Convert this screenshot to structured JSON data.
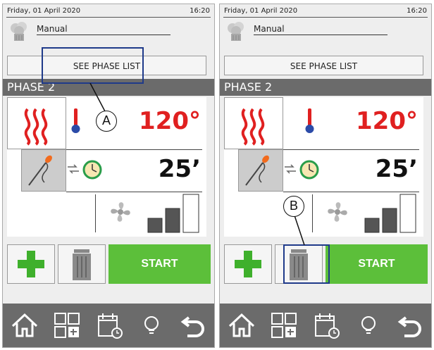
{
  "status": {
    "date": "Friday, 01 April 2020",
    "time": "16:20"
  },
  "mode": "Manual",
  "phase_list_button": "SEE PHASE LIST",
  "phase": "PHASE 2",
  "temperature": "120°",
  "duration": "25’",
  "start_button": "START",
  "callouts": {
    "a": "A",
    "b": "B"
  },
  "colors": {
    "accent_green": "#5cbf3a",
    "temp_red": "#e02020",
    "bar_gray": "#6b6b6b"
  },
  "icons": [
    "chef-hat-icon",
    "heat-waves-icon",
    "thermometer-icon",
    "probe-icon",
    "timer-icon",
    "fan-icon",
    "fan-speed-bars-icon",
    "plus-icon",
    "trash-icon",
    "home-icon",
    "grid-add-icon",
    "calendar-icon",
    "lightbulb-icon",
    "back-arrow-icon"
  ]
}
